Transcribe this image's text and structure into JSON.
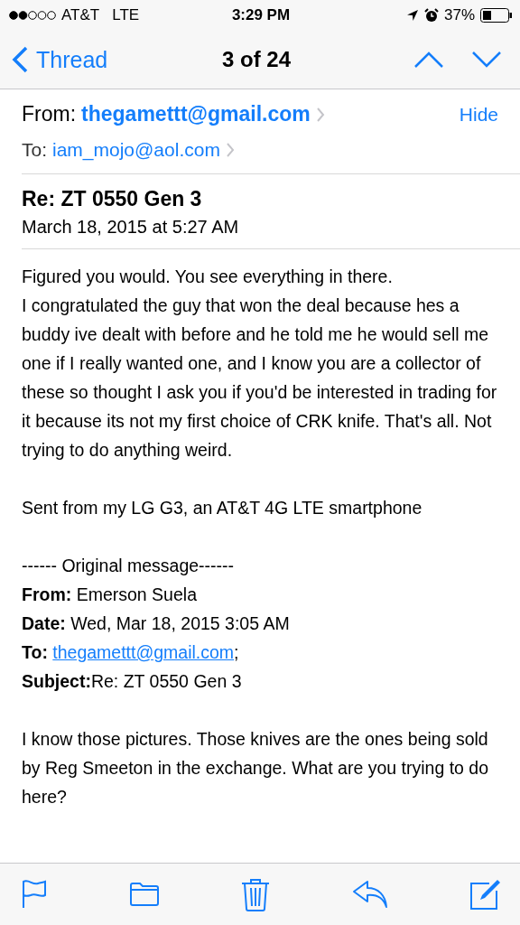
{
  "status_bar": {
    "carrier": "AT&T",
    "network": "LTE",
    "time": "3:29 PM",
    "battery": "37%"
  },
  "nav": {
    "back": "Thread",
    "title": "3 of 24"
  },
  "header": {
    "from_label": "From:",
    "from": "thegamettt@gmail.com",
    "hide": "Hide",
    "to_label": "To:",
    "to": "iam_mojo@aol.com"
  },
  "subject": "Re: ZT 0550 Gen 3",
  "date": "March 18, 2015 at 5:27 AM",
  "body": [
    {
      "kind": "text",
      "text": "Figured you would. You see everything in there."
    },
    {
      "kind": "text",
      "text": " I congratulated the guy that won the deal because hes a buddy ive dealt with before and he told me he would sell me one if I really wanted one, and I know you are a collector of these so thought I ask you if you'd be interested in trading for it because its not my first choice of CRK knife. That's all. Not trying to do anything weird."
    },
    {
      "kind": "gap"
    },
    {
      "kind": "text",
      "text": "Sent from my LG G3, an AT&T 4G LTE smartphone"
    },
    {
      "kind": "gap"
    },
    {
      "kind": "text",
      "text": "------ Original message------"
    },
    {
      "kind": "field",
      "label": "From:",
      "value": " Emerson Suela"
    },
    {
      "kind": "field",
      "label": "Date:",
      "value": " Wed, Mar 18, 2015 3:05 AM"
    },
    {
      "kind": "link",
      "label": "To:",
      "value": "thegamettt@gmail.com",
      "after": ";"
    },
    {
      "kind": "field",
      "label": "Subject:",
      "value": "Re: ZT 0550 Gen 3"
    },
    {
      "kind": "gap"
    },
    {
      "kind": "text",
      "text": "I know those pictures. Those knives are the ones being sold by Reg Smeeton in the exchange. What are you trying to do here?"
    }
  ]
}
